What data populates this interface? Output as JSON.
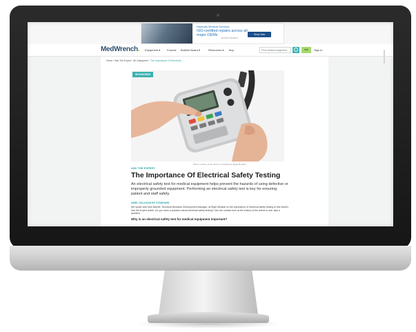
{
  "ad": {
    "small_text": "Daymark Medical Services",
    "title": "ISO-certified repairs across all major OEMs",
    "cta": "Shop Now",
    "tag": "ADVERTISEMENT"
  },
  "nav": {
    "logo_main": "MedWrench",
    "logo_mark": ".",
    "items": [
      "Equipment ▾",
      "Forums",
      "Bulletin Board ▾",
      "Resources ▾",
      "Buy"
    ],
    "search_placeholder": "Find medical equipment",
    "ask_label": "Ask",
    "signin_label": "Sign In"
  },
  "breadcrumb": {
    "items": [
      "Home",
      "Ask The Expert",
      "All Categories"
    ],
    "separator": "›",
    "current": "The Importance Of Electrical ..."
  },
  "article": {
    "badge": "SPONSORED",
    "photo_credit": "Photo courtesy of the tester's manufacturer Rigel Medical",
    "kicker": "ASK THE EXPERT",
    "title": "The Importance Of Electrical Safety Testing",
    "summary": "An electrical safety test for medical equipment helps prevent the hazards of using defective or improperly grounded equipment. Performing an electrical safety test is key for ensuring patient and staff safety.",
    "author_line": "ARIEL GALILEAN    BY STANDARD",
    "body": "We spoke with Jack Barrett, Technical Business Development Manager, at Rigel Medical on the importance of electrical safety testing in this week's Ask the Expert article. Do you have a question about electrical safety testing? Use the contact form at the bottom of the article to ask Jack a question.",
    "question": "Why is an electrical safety test for medical equipment important?"
  },
  "colors": {
    "accent_teal": "#3eb0b1",
    "logo_green": "#7dbb2a",
    "logo_navy": "#2f4f6e",
    "ask_green": "#a6d86c"
  }
}
